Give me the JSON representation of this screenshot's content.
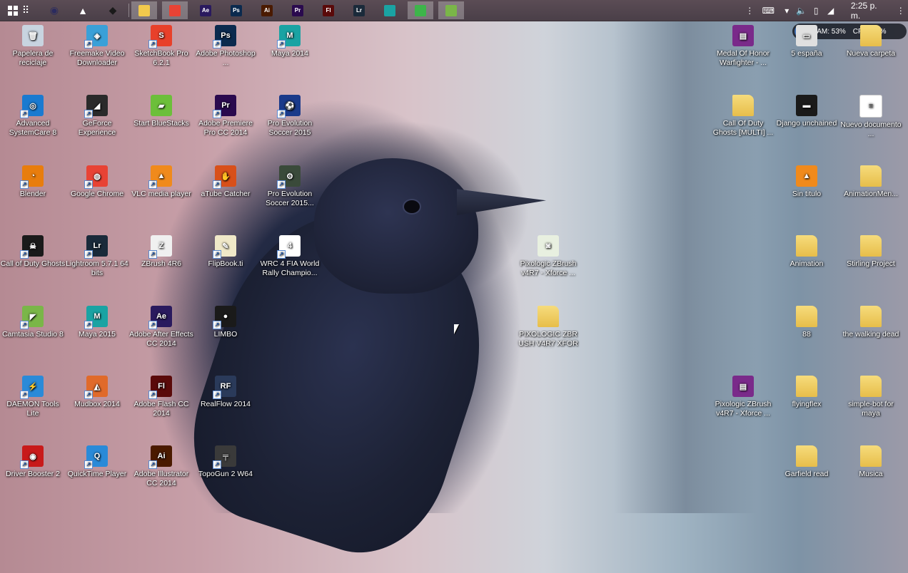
{
  "taskbar": {
    "start_icon": "windows-logo-icon",
    "pinned": [
      {
        "name": "desktop-grid-icon",
        "glyph": "⠿",
        "color": "#ffffff"
      },
      {
        "name": "obs-icon",
        "glyph": "◉",
        "color": "#2b2b5f"
      },
      {
        "name": "user-photo-icon",
        "glyph": "▲",
        "color": "#ffffff"
      },
      {
        "name": "network-icon",
        "glyph": "◆",
        "color": "#1a1a1a"
      }
    ],
    "apps": [
      {
        "name": "file-explorer-icon",
        "label": "",
        "color": "#f2c94c",
        "active": true
      },
      {
        "name": "chrome-icon",
        "label": "",
        "color": "#e84335",
        "active": true
      },
      {
        "name": "after-effects-icon",
        "label": "Ae",
        "color": "#2a1a5e",
        "active": false
      },
      {
        "name": "photoshop-icon",
        "label": "Ps",
        "color": "#0b2a4e",
        "active": false
      },
      {
        "name": "illustrator-icon",
        "label": "Ai",
        "color": "#4a1a00",
        "active": false
      },
      {
        "name": "premiere-icon",
        "label": "Pr",
        "color": "#2a0a4e",
        "active": false
      },
      {
        "name": "flash-icon",
        "label": "Fl",
        "color": "#5a0a0a",
        "active": false
      },
      {
        "name": "lightroom-icon",
        "label": "Lr",
        "color": "#1a2a3a",
        "active": false
      },
      {
        "name": "maya-icon",
        "label": "",
        "color": "#1aa3a3",
        "active": false
      },
      {
        "name": "camtasia-recorder-icon",
        "label": "",
        "color": "#3db54a",
        "active": true
      },
      {
        "name": "camtasia-icon",
        "label": "",
        "color": "#7ab648",
        "active": true
      }
    ],
    "tray": {
      "show_desktop_icon": "expand-icon",
      "keyboard_icon": "keyboard-icon",
      "chevron_icon": "chevron-down-icon",
      "volume_icon": "volume-icon",
      "battery_icon": "battery-icon",
      "signal_icon": "signal-icon",
      "time": "2:25 p. m."
    }
  },
  "gadget": {
    "ram": "RAM: 53%",
    "cpu": "CPU: 12%"
  },
  "desktop_icons": [
    {
      "id": "papelera",
      "label": "Papelera de reciclaje",
      "icon": "recycle-bin-icon",
      "glyph": "🗑",
      "color": "#c8d4e0",
      "shortcut": false
    },
    {
      "id": "freemake",
      "label": "Freemake Video Downloader",
      "icon": "freemake-icon",
      "glyph": "◈",
      "color": "#3aa0d8",
      "shortcut": true
    },
    {
      "id": "sketchbook",
      "label": "SketchBook Pro 6.2.1",
      "icon": "sketchbook-icon",
      "glyph": "S",
      "color": "#e8402a",
      "shortcut": true
    },
    {
      "id": "photoshop",
      "label": "Adobe Photoshop ...",
      "icon": "photoshop-icon",
      "glyph": "Ps",
      "color": "#0b2a4e",
      "shortcut": true
    },
    {
      "id": "maya2014",
      "label": "Maya 2014",
      "icon": "maya-icon",
      "glyph": "M",
      "color": "#1aa3a3",
      "shortcut": true
    },
    {
      "id": "advanced",
      "label": "Advanced SystemCare 8",
      "icon": "advanced-systemcare-icon",
      "glyph": "◎",
      "color": "#1a7ad0",
      "shortcut": true
    },
    {
      "id": "geforce",
      "label": "GeForce Experience",
      "icon": "geforce-icon",
      "glyph": "◢",
      "color": "#2a2a2a",
      "shortcut": true
    },
    {
      "id": "bluestacks",
      "label": "Start BlueStacks",
      "icon": "bluestacks-icon",
      "glyph": "▰",
      "color": "#6cbf3a",
      "shortcut": false
    },
    {
      "id": "premiere",
      "label": "Adobe Premiere Pro CC 2014",
      "icon": "premiere-icon",
      "glyph": "Pr",
      "color": "#2a0a4e",
      "shortcut": true
    },
    {
      "id": "pes2015a",
      "label": "Pro Evolution Soccer 2015",
      "icon": "pes-icon",
      "glyph": "⚽",
      "color": "#1a3a8a",
      "shortcut": true
    },
    {
      "id": "blender",
      "label": "Blender",
      "icon": "blender-icon",
      "glyph": "◔",
      "color": "#e87d0d",
      "shortcut": true
    },
    {
      "id": "chrome",
      "label": "Google Chrome",
      "icon": "chrome-icon",
      "glyph": "◍",
      "color": "#e84335",
      "shortcut": true
    },
    {
      "id": "vlc",
      "label": "VLC media player",
      "icon": "vlc-icon",
      "glyph": "▲",
      "color": "#f08a1c",
      "shortcut": true
    },
    {
      "id": "atube",
      "label": "aTube Catcher",
      "icon": "atube-icon",
      "glyph": "✋",
      "color": "#d8501a",
      "shortcut": true
    },
    {
      "id": "pes2015b",
      "label": "Pro Evolution Soccer 2015...",
      "icon": "pes-settings-icon",
      "glyph": "⚙",
      "color": "#3a4a3a",
      "shortcut": true
    },
    {
      "id": "codghosts",
      "label": "Call of Duty Ghosts",
      "icon": "cod-ghosts-icon",
      "glyph": "☠",
      "color": "#1a1a1a",
      "shortcut": true
    },
    {
      "id": "lightroom",
      "label": "Lightroom 5.7.1 64 bits",
      "icon": "lightroom-icon",
      "glyph": "Lr",
      "color": "#1a2a3a",
      "shortcut": true
    },
    {
      "id": "zbrush",
      "label": "ZBrush 4R6",
      "icon": "zbrush-icon",
      "glyph": "Z",
      "color": "#f0f0f0",
      "shortcut": true
    },
    {
      "id": "flipbook",
      "label": "FlipBook.ti",
      "icon": "flipbook-icon",
      "glyph": "✎",
      "color": "#f0e8c8",
      "shortcut": true
    },
    {
      "id": "wrc",
      "label": "WRC 4 FIA World Rally Champio...",
      "icon": "wrc-icon",
      "glyph": "4",
      "color": "#ffffff",
      "shortcut": true
    },
    {
      "id": "zbrushx",
      "label": "Pixologic ZBrush v4R7 - Xforce ...",
      "icon": "archive-icon",
      "glyph": "◙",
      "color": "#e8f0e0",
      "shortcut": false
    },
    {
      "id": "camtasia",
      "label": "Camtasia Studio 8",
      "icon": "camtasia-icon",
      "glyph": "◤",
      "color": "#7ab648",
      "shortcut": true
    },
    {
      "id": "maya2015",
      "label": "Maya 2015",
      "icon": "maya-2015-icon",
      "glyph": "M",
      "color": "#1aa3a3",
      "shortcut": true
    },
    {
      "id": "aftereffects",
      "label": "Adobe After Effects CC 2014",
      "icon": "after-effects-icon",
      "glyph": "Ae",
      "color": "#2a1a5e",
      "shortcut": true
    },
    {
      "id": "limbo",
      "label": "LIMBO",
      "icon": "limbo-icon",
      "glyph": "●",
      "color": "#1a1a1a",
      "shortcut": true
    },
    {
      "id": "pixologicfolder",
      "label": "PIXOLOGIC ZBR USH V4R7 XFOR CE",
      "icon": "folder-icon",
      "glyph": "",
      "color": "#f0cc5a",
      "shortcut": false,
      "folder": true
    },
    {
      "id": "daemon",
      "label": "DAEMON Tools Lite",
      "icon": "daemon-tools-icon",
      "glyph": "⚡",
      "color": "#2a8ad8",
      "shortcut": true
    },
    {
      "id": "mudbox",
      "label": "Mudbox 2014",
      "icon": "mudbox-icon",
      "glyph": "◭",
      "color": "#e06a2a",
      "shortcut": true
    },
    {
      "id": "flash",
      "label": "Adobe Flash CC 2014",
      "icon": "flash-icon",
      "glyph": "Fl",
      "color": "#5a0a0a",
      "shortcut": true
    },
    {
      "id": "realflow",
      "label": "RealFlow 2014",
      "icon": "realflow-icon",
      "glyph": "RF",
      "color": "#2a3a5a",
      "shortcut": true
    },
    {
      "id": "driverbooster",
      "label": "Driver Booster 2",
      "icon": "driver-booster-icon",
      "glyph": "◉",
      "color": "#c81a1a",
      "shortcut": true
    },
    {
      "id": "quicktime",
      "label": "QuickTime Player",
      "icon": "quicktime-icon",
      "glyph": "Q",
      "color": "#2a8ad8",
      "shortcut": true
    },
    {
      "id": "illustrator",
      "label": "Adobe Illustrator CC 2014",
      "icon": "illustrator-icon",
      "glyph": "Ai",
      "color": "#4a1a00",
      "shortcut": true
    },
    {
      "id": "topogun",
      "label": "TopoGun 2 W64",
      "icon": "topogun-icon",
      "glyph": "╤",
      "color": "#3a3a3a",
      "shortcut": true
    },
    {
      "id": "medalofhonor",
      "label": "Medal Of Honor Warfighter - ...",
      "icon": "winrar-icon",
      "glyph": "▤",
      "color": "#7a2a8a",
      "shortcut": false
    },
    {
      "id": "5espana",
      "label": "5 españa",
      "icon": "5-espana-icon",
      "glyph": "▭",
      "color": "#e0e0e0",
      "shortcut": false
    },
    {
      "id": "nuevacarpeta",
      "label": "Nueva carpeta",
      "icon": "folder-icon",
      "glyph": "",
      "color": "#f0cc5a",
      "shortcut": false,
      "folder": true
    },
    {
      "id": "codghostsmulti",
      "label": "Call Of Duty Ghosts [MULTI] ...",
      "icon": "folder-icon",
      "glyph": "",
      "color": "#f0cc5a",
      "shortcut": false,
      "folder": true
    },
    {
      "id": "django",
      "label": "Django unchained",
      "icon": "video-file-icon",
      "glyph": "▬",
      "color": "#1a1a1a",
      "shortcut": false
    },
    {
      "id": "nuevodoc",
      "label": "Nuevo documento ...",
      "icon": "text-document-icon",
      "glyph": "≡",
      "color": "#ffffff",
      "shortcut": false,
      "doc": true
    },
    {
      "id": "sintitulo",
      "label": "Sin titulo",
      "icon": "vlc-file-icon",
      "glyph": "▲",
      "color": "#f08a1c",
      "shortcut": false
    },
    {
      "id": "animationmen",
      "label": "AnimationMen...",
      "icon": "folder-icon",
      "glyph": "",
      "color": "#f0cc5a",
      "shortcut": false,
      "folder": true
    },
    {
      "id": "animation",
      "label": "Animation",
      "icon": "folder-icon",
      "glyph": "",
      "color": "#f0cc5a",
      "shortcut": false,
      "folder": true
    },
    {
      "id": "stirling",
      "label": "Stirling Project",
      "icon": "folder-icon",
      "glyph": "",
      "color": "#f0cc5a",
      "shortcut": false,
      "folder": true
    },
    {
      "id": "s8",
      "label": "88",
      "icon": "folder-icon",
      "glyph": "",
      "color": "#f0cc5a",
      "shortcut": false,
      "folder": true
    },
    {
      "id": "walkingdead",
      "label": "the walking dead",
      "icon": "folder-icon",
      "glyph": "",
      "color": "#f0cc5a",
      "shortcut": false,
      "folder": true
    },
    {
      "id": "pixologicrar",
      "label": "Pixologic ZBrush v4R7 - Xforce ...",
      "icon": "winrar-icon",
      "glyph": "▤",
      "color": "#7a2a8a",
      "shortcut": false
    },
    {
      "id": "flyingflex",
      "label": "flyingflex",
      "icon": "folder-icon",
      "glyph": "",
      "color": "#f0cc5a",
      "shortcut": false,
      "folder": true
    },
    {
      "id": "simplebot",
      "label": "simple-bot for maya",
      "icon": "folder-icon",
      "glyph": "",
      "color": "#f0cc5a",
      "shortcut": false,
      "folder": true
    },
    {
      "id": "garfield",
      "label": "Garfield read",
      "icon": "folder-icon",
      "glyph": "",
      "color": "#f0cc5a",
      "shortcut": false,
      "folder": true
    },
    {
      "id": "musica",
      "label": "Musica",
      "icon": "folder-icon",
      "glyph": "",
      "color": "#f0cc5a",
      "shortcut": false,
      "folder": true
    }
  ]
}
